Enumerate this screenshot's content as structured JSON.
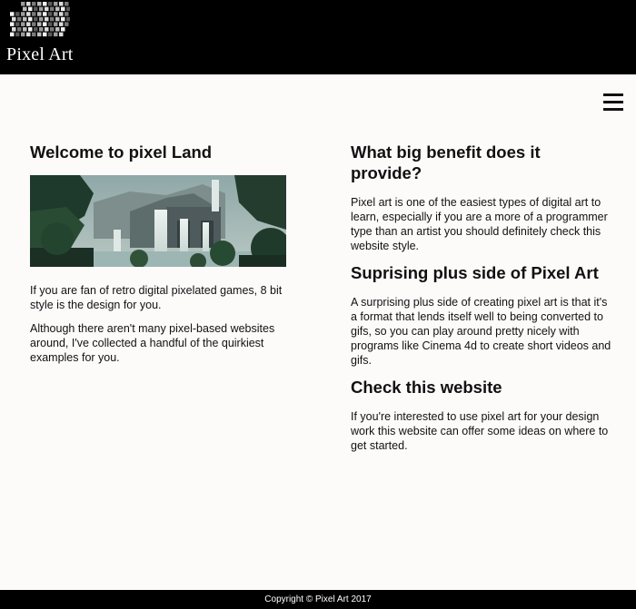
{
  "header": {
    "site_title": "Pixel Art",
    "logo_icon": "pixel-cube-logo-icon",
    "menu_icon": "hamburger-menu-icon"
  },
  "left": {
    "heading": "Welcome to pixel Land",
    "hero_image": "pixel-art-waterfall-landscape",
    "p1": "If you are fan of retro digital pixelated games, 8 bit style is the design for you.",
    "p2": "Although there aren't many pixel-based websites around, I've collected a handful of the quirkiest examples for you."
  },
  "right": {
    "heading1": "What big benefit does it provide?",
    "p1": "Pixel art is one of the easiest types of digital art to learn, especially if you are a more of a programmer type than an artist you should definitely check this website style.",
    "heading2": "Suprising plus side of Pixel Art",
    "p2": "A surprising plus side of creating pixel art is that it's a format that lends itself well to being converted to gifs, so you can play around pretty nicely with programs like Cinema 4d to create short videos and gifs.",
    "heading3": "Check this website",
    "p3": "If you're interested to use pixel art for your design work this website can offer some ideas on where to get started."
  },
  "footer": {
    "copyright": "Copyright © Pixel Art 2017"
  },
  "colors": {
    "header_bg": "#000000",
    "page_bg": "#fdfafa",
    "text": "#111111"
  }
}
